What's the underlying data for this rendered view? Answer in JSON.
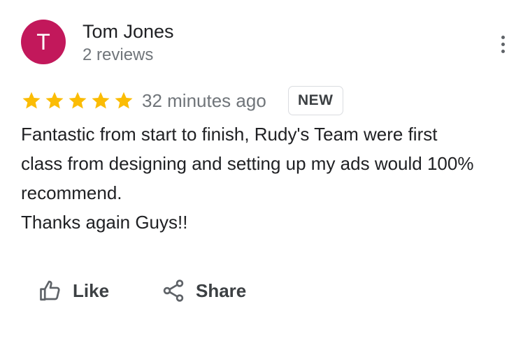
{
  "reviewer": {
    "initial": "T",
    "name": "Tom Jones",
    "review_count": "2 reviews",
    "avatar_color": "#c2185b"
  },
  "review": {
    "rating": 5,
    "max_rating": 5,
    "star_color": "#fbbc04",
    "time": "32 minutes ago",
    "badge": "NEW",
    "text_lines": [
      "Fantastic from start to finish, Rudy's Team were first",
      "class from designing and setting up my ads would 100%",
      "recommend.",
      "Thanks again Guys!!"
    ]
  },
  "actions": {
    "like_label": "Like",
    "share_label": "Share",
    "more_icon": "more-vert-icon",
    "like_icon": "thumb-up-icon",
    "share_icon": "share-icon"
  }
}
